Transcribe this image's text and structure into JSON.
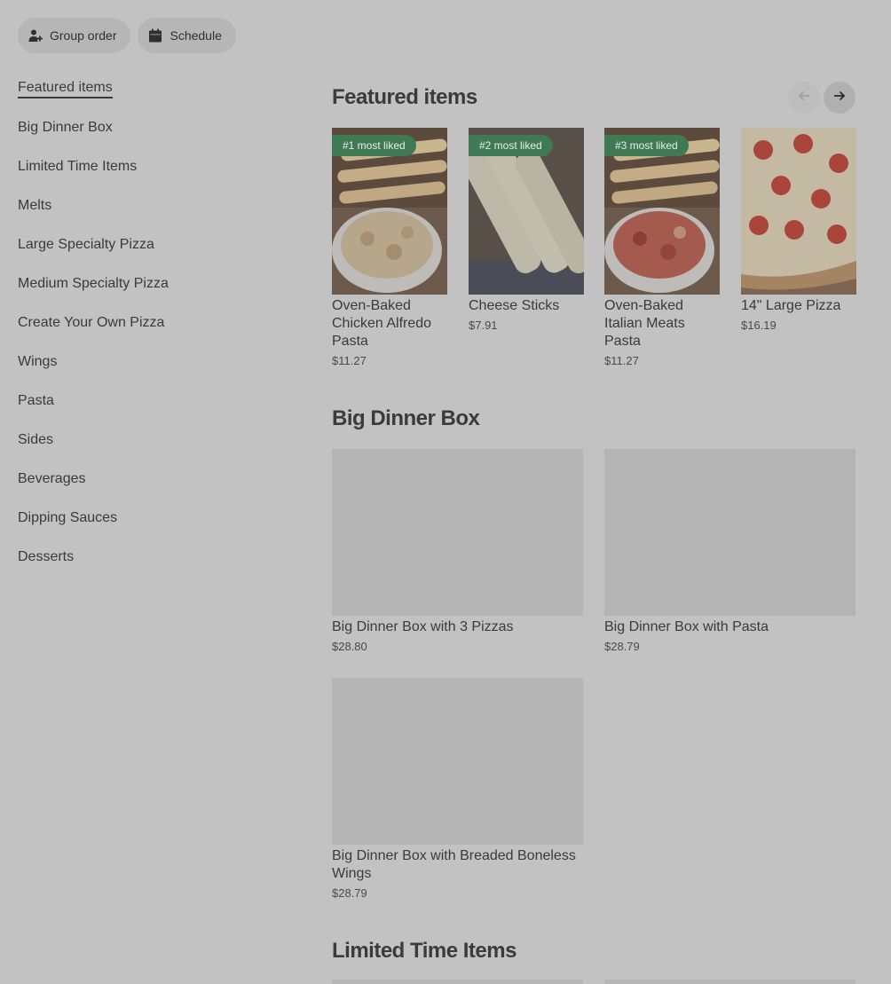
{
  "top_actions": {
    "group_order": "Group order",
    "schedule": "Schedule"
  },
  "sidebar": {
    "items": [
      {
        "label": "Featured items",
        "active": true
      },
      {
        "label": "Big Dinner Box"
      },
      {
        "label": "Limited Time Items"
      },
      {
        "label": "Melts"
      },
      {
        "label": "Large Specialty Pizza"
      },
      {
        "label": "Medium Specialty Pizza"
      },
      {
        "label": "Create Your Own Pizza"
      },
      {
        "label": "Wings"
      },
      {
        "label": "Pasta"
      },
      {
        "label": "Sides"
      },
      {
        "label": "Beverages"
      },
      {
        "label": "Dipping Sauces"
      },
      {
        "label": "Desserts"
      }
    ]
  },
  "featured": {
    "title": "Featured items",
    "items": [
      {
        "badge": "#1 most liked",
        "name": "Oven-Baked Chicken Alfredo Pasta",
        "price": "$11.27",
        "image": "alfredo-pasta-with-breadsticks"
      },
      {
        "badge": "#2 most liked",
        "name": "Cheese Sticks",
        "price": "$7.91",
        "image": "cheese-sticks-with-marinara"
      },
      {
        "badge": "#3 most liked",
        "name": "Oven-Baked Italian Meats Pasta",
        "price": "$11.27",
        "image": "italian-meats-pasta-with-breadsticks"
      },
      {
        "badge": "",
        "name": "14\" Large Pizza",
        "price": "$16.19",
        "image": "pepperoni-pizza"
      }
    ]
  },
  "big_dinner_box": {
    "title": "Big Dinner Box",
    "items": [
      {
        "name": "Big Dinner Box with 3 Pizzas",
        "price": "$28.80"
      },
      {
        "name": "Big Dinner Box with Pasta",
        "price": "$28.79"
      },
      {
        "name": "Big Dinner Box with Breaded Boneless Wings",
        "price": "$28.79"
      }
    ]
  },
  "limited_time": {
    "title": "Limited Time Items"
  },
  "colors": {
    "overlay_background": "#c2c2c2",
    "badge_green": "#3f7a55",
    "placeholder_image": "#b4b4b4"
  },
  "icons": {
    "group_order": "person-add-icon",
    "schedule": "calendar-icon",
    "prev": "arrow-left-icon",
    "next": "arrow-right-icon"
  }
}
